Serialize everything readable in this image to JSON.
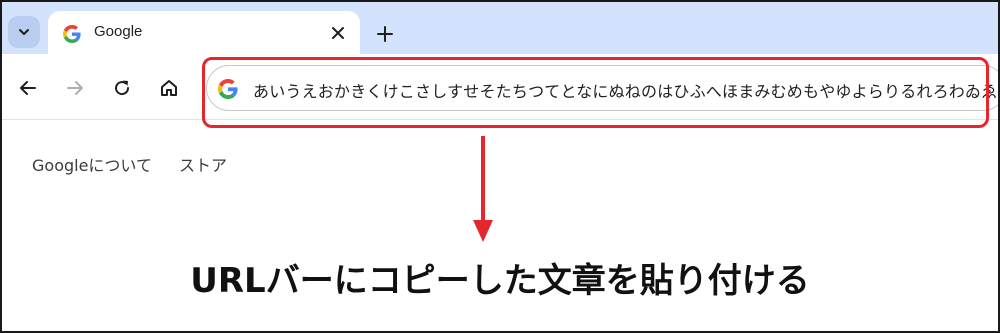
{
  "browser": {
    "tab": {
      "title": "Google"
    },
    "omnibox": {
      "url_text": "あいうえおかきくけこさしすせそたちつてとなにぬねのはひふへほまみむめもやゆよらりるれろわゐゑをん"
    },
    "icons": {
      "tab_search": "chevron-down-icon",
      "favicon": "google-icon",
      "close": "close-icon",
      "new_tab": "plus-icon",
      "back": "arrow-left-icon",
      "forward": "arrow-right-icon",
      "reload": "reload-icon",
      "home": "home-icon"
    }
  },
  "page": {
    "links": [
      "Googleについて",
      "ストア"
    ]
  },
  "annotation": {
    "caption": "URLバーにコピーした文章を貼り付ける",
    "color": "#e6262d"
  },
  "colors": {
    "tabstrip": "#d3e3fd",
    "highlight": "#e6262d"
  }
}
